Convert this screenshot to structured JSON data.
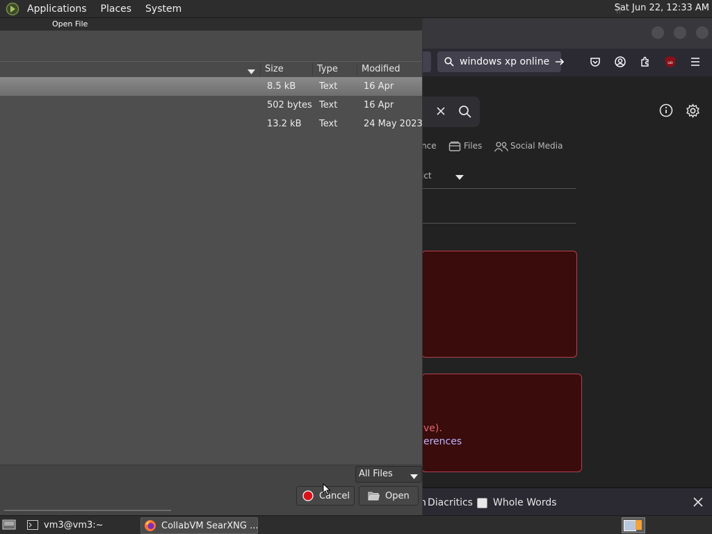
{
  "top_panel": {
    "menus": [
      "Applications",
      "Places",
      "System"
    ],
    "clock": "Sat Jun 22, 12:33 AM"
  },
  "browser": {
    "url_text": "windows xp online",
    "categories": {
      "partial": "nce",
      "files": "Files",
      "social": "Social Media"
    },
    "filter_partial": "ict",
    "error_fragments": {
      "line1": "ve).",
      "line2": "erences"
    },
    "findbar": {
      "diacritics": "Diacritics",
      "diacritics_prefix": "n",
      "whole_words": "Whole Words"
    }
  },
  "dialog": {
    "title": "Open File",
    "columns": {
      "size": "Size",
      "type": "Type",
      "modified": "Modified"
    },
    "files": [
      {
        "size": "8.5 kB",
        "type": "Text",
        "modified": "16 Apr"
      },
      {
        "size": "502 bytes",
        "type": "Text",
        "modified": "16 Apr"
      },
      {
        "size": "13.2 kB",
        "type": "Text",
        "modified": "24 May 2023"
      }
    ],
    "filter_value": "All Files",
    "cancel_label": "Cancel",
    "open_label": "Open"
  },
  "taskbar": {
    "items": [
      "vm3@vm3:~",
      "CollabVM SearXNG ..."
    ]
  },
  "colors": {
    "panel": "#2d2d2d",
    "dialog_bg": "#4e4e4e",
    "selected_row": "#7c7c7c",
    "error_bg": "#3a0c0c",
    "error_border": "#b5414e"
  }
}
